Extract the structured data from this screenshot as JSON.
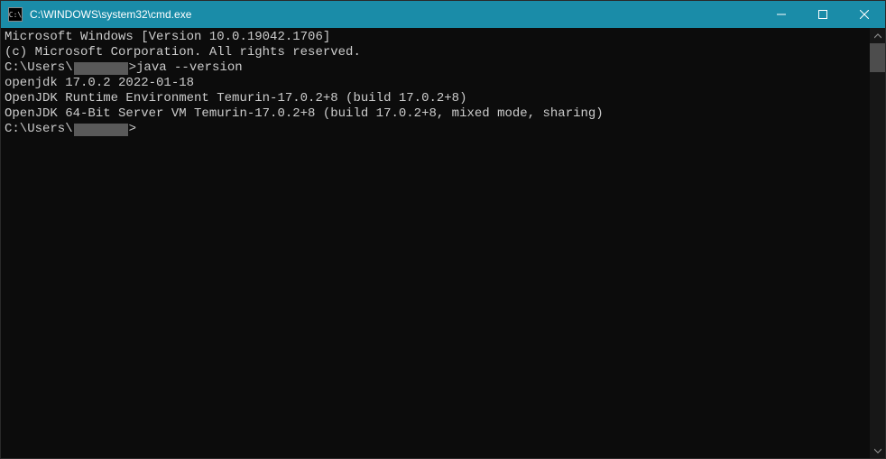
{
  "titlebar": {
    "icon_label": "C:\\",
    "title": "C:\\WINDOWS\\system32\\cmd.exe"
  },
  "terminal": {
    "line1": "Microsoft Windows [Version 10.0.19042.1706]",
    "line2": "(c) Microsoft Corporation. All rights reserved.",
    "blank1": "",
    "prompt1_prefix": "C:\\Users\\",
    "prompt1_suffix": ">java --version",
    "out1": "openjdk 17.0.2 2022-01-18",
    "out2": "OpenJDK Runtime Environment Temurin-17.0.2+8 (build 17.0.2+8)",
    "out3": "OpenJDK 64-Bit Server VM Temurin-17.0.2+8 (build 17.0.2+8, mixed mode, sharing)",
    "blank2": "",
    "prompt2_prefix": "C:\\Users\\",
    "prompt2_suffix": ">"
  }
}
